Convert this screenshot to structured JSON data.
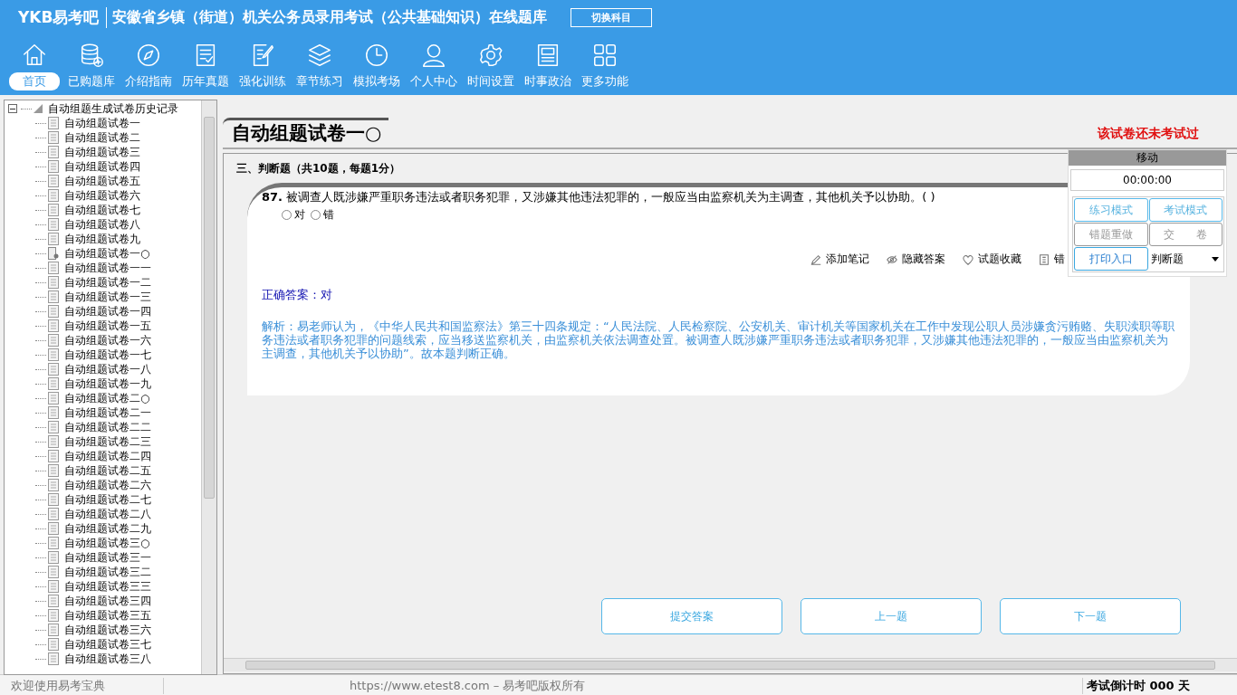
{
  "app": {
    "logo": "YKB易考吧",
    "title": "安徽省乡镇（街道）机关公务员录用考试（公共基础知识）在线题库",
    "switch_button": "切换科目"
  },
  "nav": [
    {
      "label": "首页",
      "selected": true
    },
    {
      "label": "已购题库",
      "selected": false
    },
    {
      "label": "介绍指南",
      "selected": false
    },
    {
      "label": "历年真题",
      "selected": false
    },
    {
      "label": "强化训练",
      "selected": false
    },
    {
      "label": "章节练习",
      "selected": false
    },
    {
      "label": "模拟考场",
      "selected": false
    },
    {
      "label": "个人中心",
      "selected": false
    },
    {
      "label": "时间设置",
      "selected": false
    },
    {
      "label": "时事政治",
      "selected": false
    },
    {
      "label": "更多功能",
      "selected": false
    }
  ],
  "tree": {
    "label": "自动组题生成试卷历史记录",
    "expanded": true,
    "children": [
      {
        "label": "自动组题试卷一",
        "kind": "paper"
      },
      {
        "label": "自动组题试卷二",
        "kind": "paper"
      },
      {
        "label": "自动组题试卷三",
        "kind": "paper"
      },
      {
        "label": "自动组题试卷四",
        "kind": "paper"
      },
      {
        "label": "自动组题试卷五",
        "kind": "paper"
      },
      {
        "label": "自动组题试卷六",
        "kind": "paper"
      },
      {
        "label": "自动组题试卷七",
        "kind": "paper"
      },
      {
        "label": "自动组题试卷八",
        "kind": "paper"
      },
      {
        "label": "自动组题试卷九",
        "kind": "paper"
      },
      {
        "label": "自动组题试卷一○",
        "kind": "open"
      },
      {
        "label": "自动组题试卷一一",
        "kind": "paper"
      },
      {
        "label": "自动组题试卷一二",
        "kind": "paper"
      },
      {
        "label": "自动组题试卷一三",
        "kind": "paper"
      },
      {
        "label": "自动组题试卷一四",
        "kind": "paper"
      },
      {
        "label": "自动组题试卷一五",
        "kind": "paper"
      },
      {
        "label": "自动组题试卷一六",
        "kind": "paper"
      },
      {
        "label": "自动组题试卷一七",
        "kind": "paper"
      },
      {
        "label": "自动组题试卷一八",
        "kind": "paper"
      },
      {
        "label": "自动组题试卷一九",
        "kind": "paper"
      },
      {
        "label": "自动组题试卷二○",
        "kind": "paper"
      },
      {
        "label": "自动组题试卷二一",
        "kind": "paper"
      },
      {
        "label": "自动组题试卷二二",
        "kind": "paper"
      },
      {
        "label": "自动组题试卷二三",
        "kind": "paper"
      },
      {
        "label": "自动组题试卷二四",
        "kind": "paper"
      },
      {
        "label": "自动组题试卷二五",
        "kind": "paper"
      },
      {
        "label": "自动组题试卷二六",
        "kind": "paper"
      },
      {
        "label": "自动组题试卷二七",
        "kind": "paper"
      },
      {
        "label": "自动组题试卷二八",
        "kind": "paper"
      },
      {
        "label": "自动组题试卷二九",
        "kind": "paper"
      },
      {
        "label": "自动组题试卷三○",
        "kind": "paper"
      },
      {
        "label": "自动组题试卷三一",
        "kind": "paper"
      },
      {
        "label": "自动组题试卷三二",
        "kind": "paper"
      },
      {
        "label": "自动组题试卷三三",
        "kind": "paper"
      },
      {
        "label": "自动组题试卷三四",
        "kind": "paper"
      },
      {
        "label": "自动组题试卷三五",
        "kind": "paper"
      },
      {
        "label": "自动组题试卷三六",
        "kind": "paper"
      },
      {
        "label": "自动组题试卷三七",
        "kind": "paper"
      },
      {
        "label": "自动组题试卷三八",
        "kind": "paper"
      }
    ]
  },
  "paper_title": "自动组题试卷一○",
  "exam_status": "该试卷还未考试过",
  "section": "三、判断题（共10题，每题1分）",
  "question": {
    "number": "87.",
    "text": "被调查人既涉嫌严重职务违法或者职务犯罪，又涉嫌其他违法犯罪的，一般应当由监察机关为主调查，其他机关予以协助。( )",
    "options": [
      {
        "label": "对",
        "selected": false
      },
      {
        "label": "错",
        "selected": false
      }
    ]
  },
  "actions": [
    "添加笔记",
    "隐藏答案",
    "试题收藏",
    "错"
  ],
  "answer": "正确答案：对",
  "analysis": "解析：易老师认为，《中华人民共和国监察法》第三十四条规定：“人民法院、人民检察院、公安机关、审计机关等国家机关在工作中发现公职人员涉嫌贪污贿赂、失职渎职等职务违法或者职务犯罪的问题线索，应当移送监察机关，由监察机关依法调查处置。被调查人既涉嫌严重职务违法或者职务犯罪，又涉嫌其他违法犯罪的，一般应当由监察机关为主调查，其他机关予以协助”。故本题判断正确。",
  "bottom_buttons": [
    "提交答案",
    "上一题",
    "下一题"
  ],
  "panel": {
    "title": "移动",
    "timer": "00:00:00",
    "buttons": [
      {
        "label": "练习模式",
        "kind": "blue"
      },
      {
        "label": "考试模式",
        "kind": "blue"
      },
      {
        "label": "错题重做",
        "kind": "gray"
      },
      {
        "label": "交　　卷",
        "kind": "gray"
      },
      {
        "label": "打印入口",
        "kind": "dark"
      }
    ],
    "type_select": "判断题"
  },
  "status_bar": {
    "welcome": "欢迎使用易考宝典",
    "copyright": "https://www.etest8.com – 易考吧版权所有",
    "countdown": "考试倒计时 000 天"
  }
}
